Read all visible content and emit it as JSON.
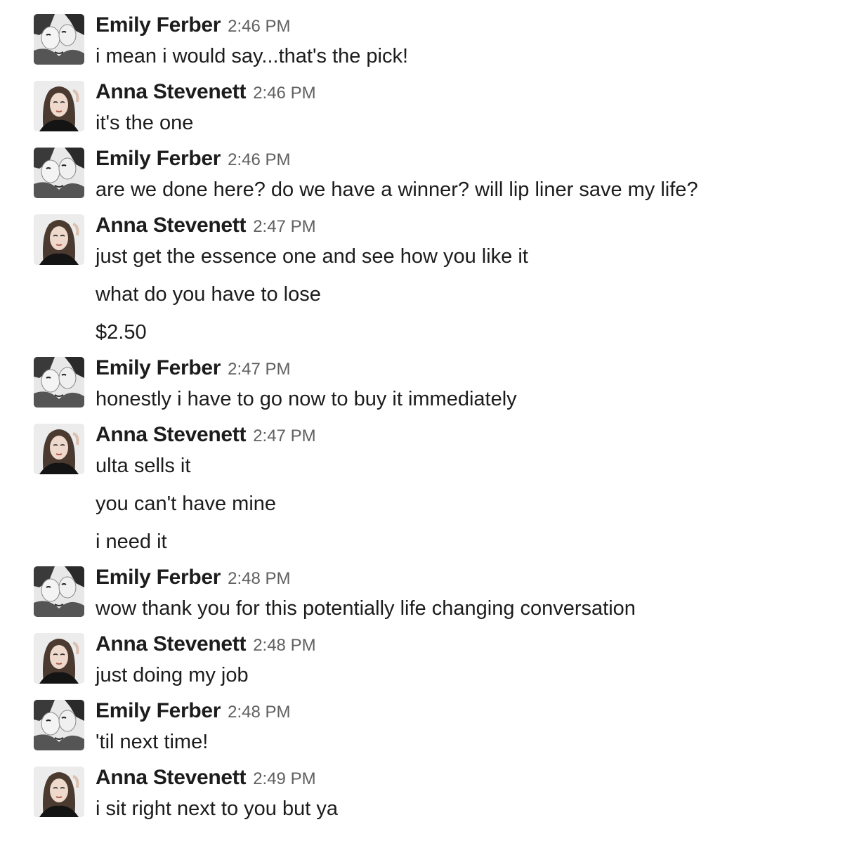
{
  "messages": [
    {
      "author": "Emily Ferber",
      "avatar": "emily",
      "time": "2:46 PM",
      "lines": [
        "i mean i would say...that's the pick!"
      ]
    },
    {
      "author": "Anna Stevenett",
      "avatar": "anna",
      "time": "2:46 PM",
      "lines": [
        "it's the one"
      ]
    },
    {
      "author": "Emily Ferber",
      "avatar": "emily",
      "time": "2:46 PM",
      "lines": [
        "are we done here? do we have a winner? will lip liner save my life?"
      ]
    },
    {
      "author": "Anna Stevenett",
      "avatar": "anna",
      "time": "2:47 PM",
      "lines": [
        "just get the essence one and see how you like it",
        "what do you have to lose",
        "$2.50"
      ]
    },
    {
      "author": "Emily Ferber",
      "avatar": "emily",
      "time": "2:47 PM",
      "lines": [
        "honestly i have to go now to buy it immediately"
      ]
    },
    {
      "author": "Anna Stevenett",
      "avatar": "anna",
      "time": "2:47 PM",
      "lines": [
        "ulta sells it",
        "you can't have mine",
        "i need it"
      ]
    },
    {
      "author": "Emily Ferber",
      "avatar": "emily",
      "time": "2:48 PM",
      "lines": [
        "wow thank you for this potentially life changing conversation"
      ]
    },
    {
      "author": "Anna Stevenett",
      "avatar": "anna",
      "time": "2:48 PM",
      "lines": [
        "just doing my job"
      ]
    },
    {
      "author": "Emily Ferber",
      "avatar": "emily",
      "time": "2:48 PM",
      "lines": [
        "'til next time!"
      ]
    },
    {
      "author": "Anna Stevenett",
      "avatar": "anna",
      "time": "2:49 PM",
      "lines": [
        "i sit right next to you but ya"
      ]
    }
  ]
}
